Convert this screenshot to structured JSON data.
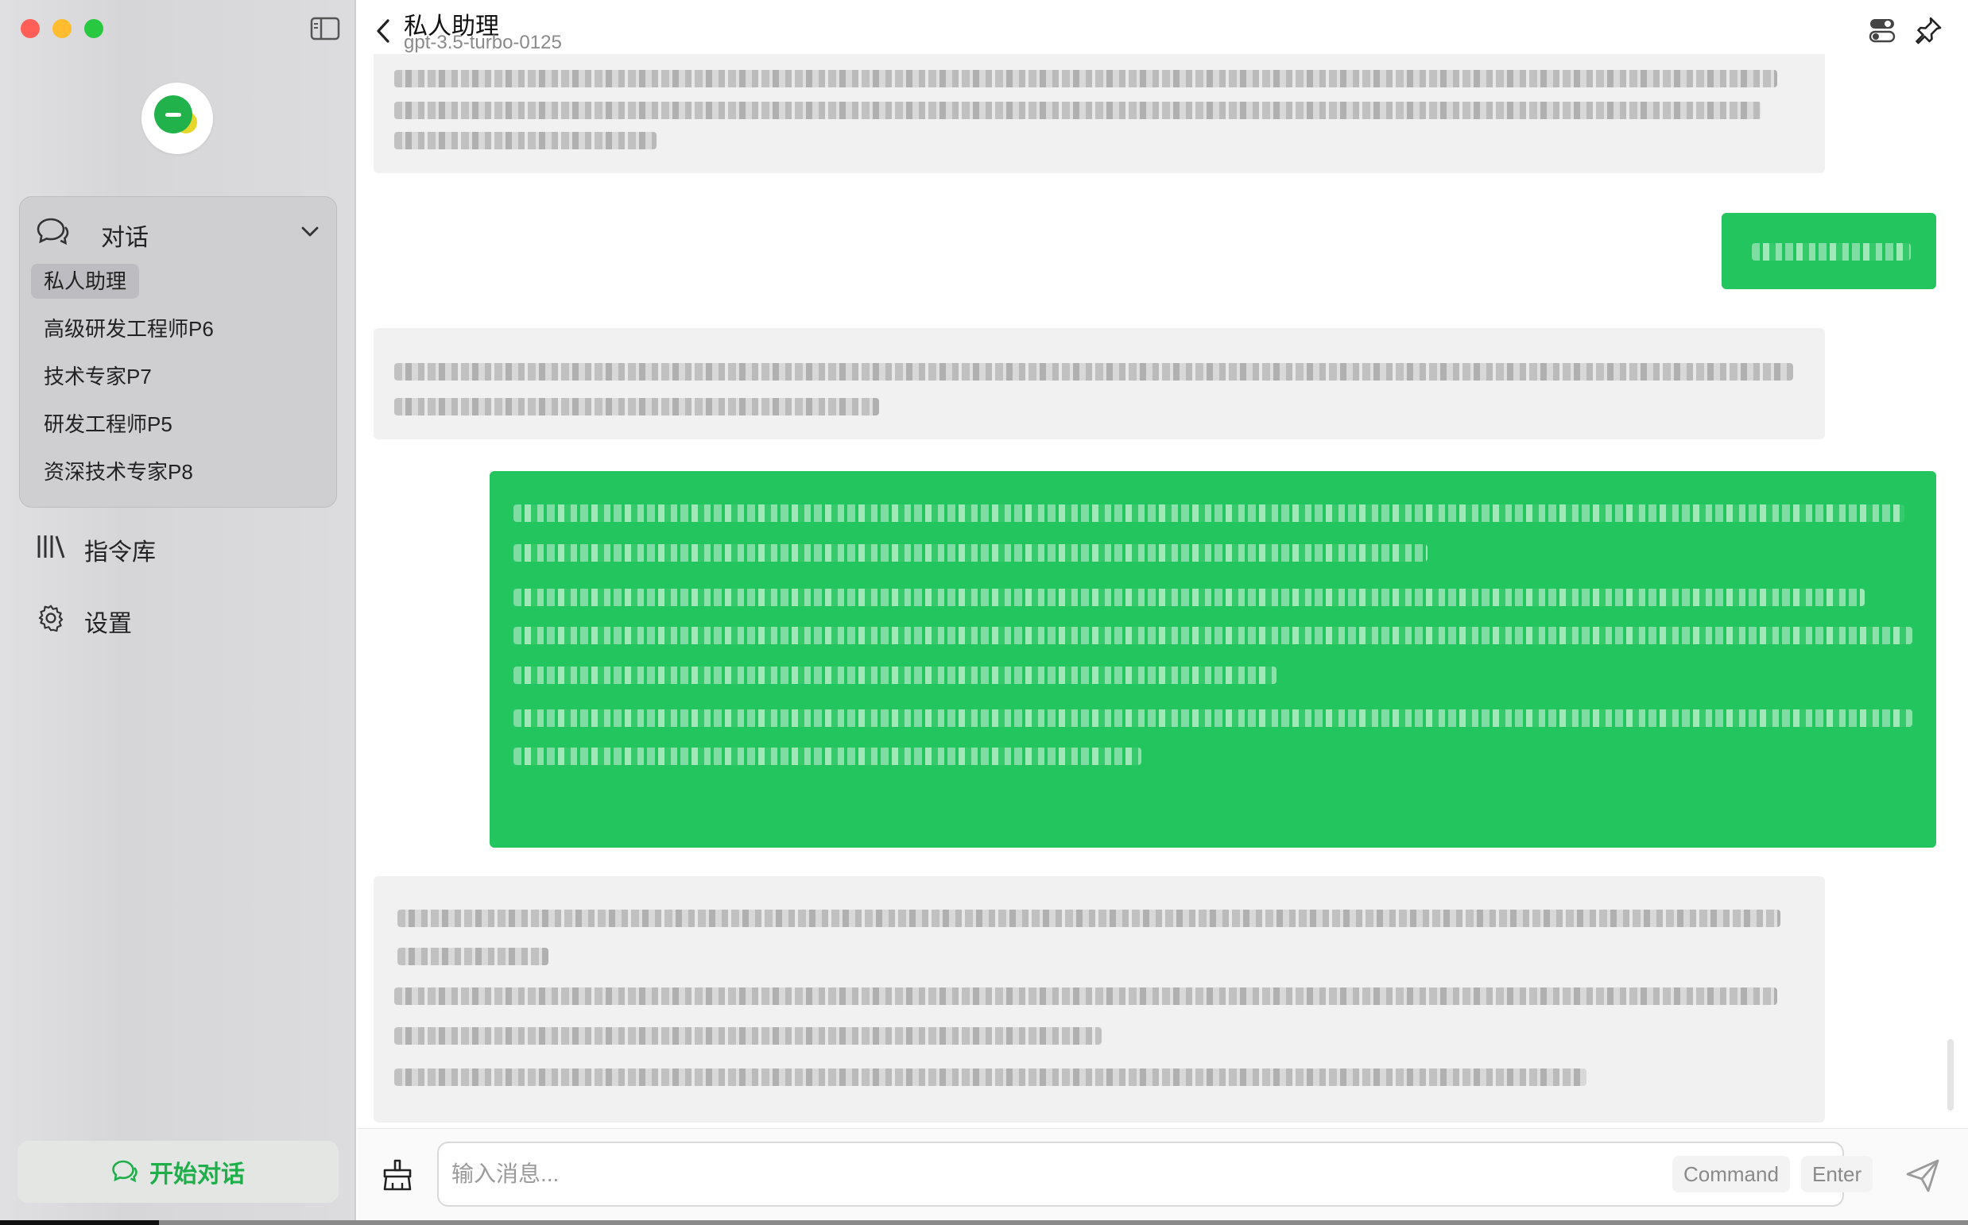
{
  "sidebar": {
    "conversations_header": "对话",
    "conversations": [
      {
        "label": "私人助理",
        "active": true
      },
      {
        "label": "高级研发工程师P6",
        "active": false
      },
      {
        "label": "技术专家P7",
        "active": false
      },
      {
        "label": "研发工程师P5",
        "active": false
      },
      {
        "label": "资深技术专家P8",
        "active": false
      }
    ],
    "nav": [
      {
        "label": "指令库",
        "icon": "library-icon"
      },
      {
        "label": "设置",
        "icon": "gear-icon"
      }
    ],
    "start_button": "开始对话"
  },
  "header": {
    "title": "私人助理",
    "model": "gpt-3.5-turbo-0125"
  },
  "input": {
    "placeholder": "输入消息...",
    "hint_command": "Command",
    "hint_enter": "Enter"
  },
  "colors": {
    "accent": "#22c55e",
    "user_bubble": "#22c55e",
    "ai_bubble": "#f1f1f1",
    "sidebar_bg": "#dadadc"
  }
}
